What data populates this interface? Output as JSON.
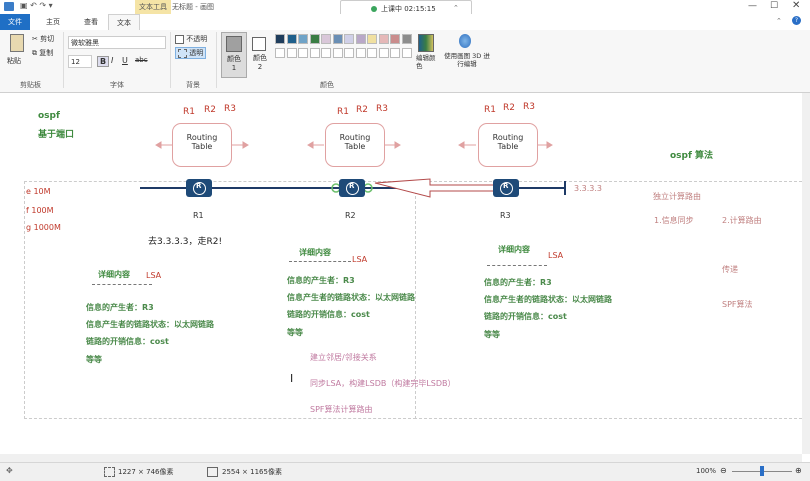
{
  "titlebar": {
    "app_title": "无标题 - 画图",
    "session_text": "上课中 02:15:15"
  },
  "tabs": {
    "file": "文件",
    "home": "主页",
    "view": "查看",
    "text_tools": "文本工具",
    "text": "文本"
  },
  "ribbon": {
    "paste": "粘贴",
    "cut": "剪切",
    "copy": "复制",
    "font_name": "微软雅黑",
    "font_size": "12",
    "opaque": "不透明",
    "transparent": "透明",
    "color1_label": "颜色 1",
    "color2_label": "颜色 2",
    "edit_colors": "编辑颜色",
    "paint3d": "使用画图 3D 进行编辑",
    "group_clipboard": "剪贴板",
    "group_font": "字体",
    "group_background": "背景",
    "group_colors": "颜色"
  },
  "palette": {
    "row1": [
      "#1f3d5c",
      "#1f5f8b",
      "#6fa3c7",
      "#3a7d44",
      "#d9c7d9",
      "#6a8fb5",
      "#d0d0e8",
      "#b9a8c8",
      "#f0e0a0",
      "#e5b8b8",
      "#c98c8c",
      "#8c8c8c"
    ],
    "row2": [
      "#ffffff",
      "#ffffff",
      "#ffffff",
      "#ffffff",
      "#ffffff",
      "#ffffff",
      "#ffffff",
      "#ffffff",
      "#ffffff",
      "#ffffff",
      "#ffffff",
      "#ffffff"
    ],
    "color1": "#a0a0a0",
    "color2": "#ffffff"
  },
  "canvas": {
    "ospf_label": "ospf",
    "based_on_port": "基于端口",
    "routers": [
      {
        "name": "R1",
        "tag_r1": "R1",
        "tag_r2": "R2",
        "tag_r3": "R3",
        "rt_line1": "Routing",
        "rt_line2": "Table"
      },
      {
        "name": "R2",
        "tag_r1": "R1",
        "tag_r2": "R2",
        "tag_r3": "R3",
        "rt_line1": "Routing",
        "rt_line2": "Table"
      },
      {
        "name": "R3",
        "tag_r1": "R1",
        "tag_r2": "R2",
        "tag_r3": "R3",
        "rt_line1": "Routing",
        "rt_line2": "Table"
      }
    ],
    "dest_ip": "3.3.3.3",
    "bandwidth": [
      "e 10M",
      "f  100M",
      "g  1000M"
    ],
    "goto_text": "去3.3.3.3，走R2!",
    "lsa_blocks": [
      {
        "title": "详细内容",
        "lsa": "LSA",
        "line1": "信息的产生者：R3",
        "line2": "信息产生者的链路状态：以太网链路",
        "line3": "链路的开销信息：cost",
        "line4": "等等"
      },
      {
        "title": "详细内容",
        "lsa": "LSA",
        "line1": "信息的产生者：R3",
        "line2": "信息产生者的链路状态：以太网链路",
        "line3": "链路的开销信息：cost",
        "line4": "等等"
      },
      {
        "title": "详细内容",
        "lsa": "LSA",
        "line1": "信息的产生者：R3",
        "line2": "信息产生者的链路状态：以太网链路",
        "line3": "链路的开销信息：cost",
        "line4": "等等"
      }
    ],
    "steps": [
      "建立邻居/邻接关系",
      "同步LSA，构建LSDB（构建完毕LSDB）",
      "SPF算法计算路由"
    ],
    "right": {
      "algo_title": "ospf 算法",
      "independent": "独立计算路由",
      "item1": "1.信息同步",
      "item2": "2.计算路由",
      "flood": "传递",
      "spf": "SPF算法"
    }
  },
  "status": {
    "selection_size": "1227 × 746像素",
    "canvas_size": "2554 × 1165像素",
    "zoom": "100%"
  }
}
